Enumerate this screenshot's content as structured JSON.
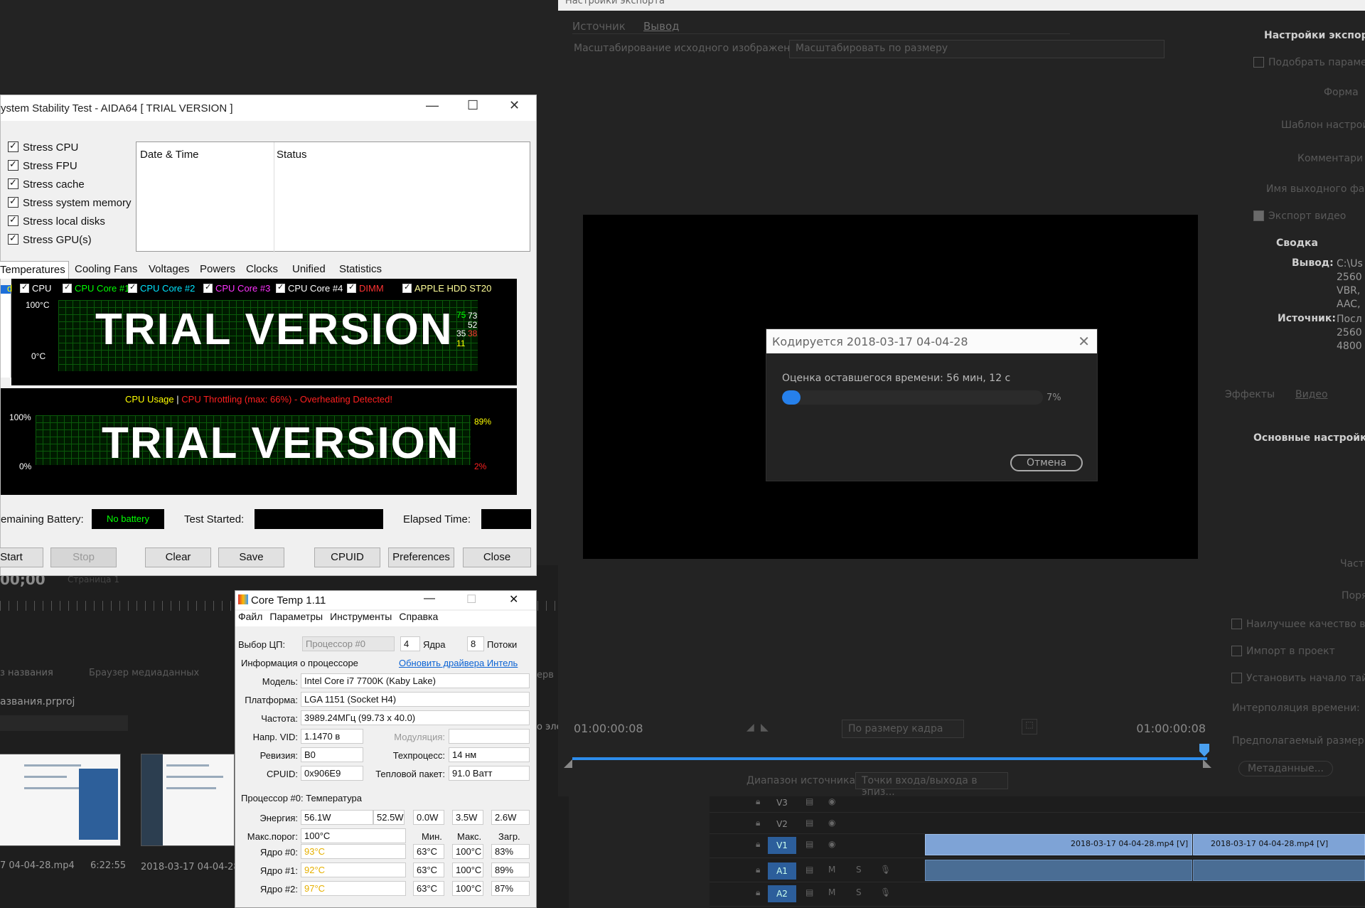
{
  "premiere_export": {
    "title": "Настройки экспорта",
    "tabs": [
      "Источник",
      "Вывод"
    ],
    "scale_label": "Масштабирование исходного изображения:",
    "scale_value": "Масштабировать по размеру",
    "right_panel": {
      "export_settings": "Настройки экспорта",
      "match_params": "Подобрать параме",
      "format": "Форма",
      "preset": "Шаблон настрой",
      "comment": "Комментари",
      "output_name": "Имя выходного фай",
      "export_video": "Экспорт видео",
      "summary": "Сводка",
      "output_label": "Вывод:",
      "output_lines": [
        "C:\\Us",
        "2560",
        "VBR,",
        "AAC,"
      ],
      "source_label": "Источник:",
      "source_lines": [
        "Посл",
        "2560",
        "4800"
      ],
      "effects_tab": "Эффекты",
      "video_tab": "Видео",
      "basic_settings": "Основные настройки",
      "freq": "Часто",
      "order": "Поря",
      "best_quality": "Наилучшее качество в",
      "import_project": "Импорт в проект",
      "set_start": "Установить начало тай",
      "interp": "Интерполяция времени:",
      "est_size": "Предполагаемый размер",
      "metadata": "Метаданные..."
    },
    "timecode_left": "01:00:00:08",
    "timecode_right": "01:00:00:08",
    "fit_select": "По размеру кадра",
    "source_range_label": "Диапазон источника:",
    "source_range_value": "Точки входа/выхода в эпиз..."
  },
  "encode_dialog": {
    "title": "Кодируется 2018-03-17 04-04-28",
    "eta": "Оценка оставшегося времени: 56 мин, 12 с",
    "progress": 0.07,
    "percent_text": "7%",
    "cancel": "Отмена"
  },
  "premiere_back": {
    "timecode": "00;00",
    "page": "Страница 1",
    "project_tab": "з названия",
    "media_tab": "Браузер медиаданных",
    "project_file": "азвания.prproj",
    "clip1_name": "7 04-04-28.mp4",
    "clip1_dur": "6:22:55",
    "clip2_name": "2018-03-17 04-04-28",
    "side_text1": "ерв",
    "side_text2": "о эле"
  },
  "timeline": {
    "tracks": [
      "V3",
      "V2",
      "V1",
      "A1",
      "A2"
    ],
    "clip_a": "2018-03-17 04-04-28.mp4 [V]",
    "clip_b": "2018-03-17 04-04-28.mp4 [V]",
    "mute": "M",
    "solo": "S"
  },
  "aida": {
    "title": "ystem Stability Test - AIDA64  [ TRIAL VERSION ]",
    "stress": [
      "Stress CPU",
      "Stress FPU",
      "Stress cache",
      "Stress system memory",
      "Stress local disks",
      "Stress GPU(s)"
    ],
    "log_headers": [
      "Date & Time",
      "Status"
    ],
    "tabs": [
      "Temperatures",
      "Cooling Fans",
      "Voltages",
      "Powers",
      "Clocks",
      "Unified",
      "Statistics"
    ],
    "legend": [
      {
        "label": "d",
        "color": "#ffff00"
      },
      {
        "label": "CPU",
        "color": "#ffffff"
      },
      {
        "label": "CPU Core #1",
        "color": "#00ff00"
      },
      {
        "label": "CPU Core #2",
        "color": "#00e5ff"
      },
      {
        "label": "CPU Core #3",
        "color": "#ff33ff"
      },
      {
        "label": "CPU Core #4",
        "color": "#ffffff"
      },
      {
        "label": "DIMM",
        "color": "#ff3333"
      },
      {
        "label": "APPLE HDD ST20",
        "color": "#ffff99"
      }
    ],
    "temp_top": "100°C",
    "temp_bottom": "0°C",
    "temp_readings": [
      {
        "v": "75",
        "c": "#00ff00"
      },
      {
        "v": "73",
        "c": "#ffffff"
      },
      {
        "v": "52",
        "c": "#ffffff"
      },
      {
        "v": "35",
        "c": "#ffffff"
      },
      {
        "v": "38",
        "c": "#ff3333"
      },
      {
        "v": "11",
        "c": "#ffff00"
      }
    ],
    "trial_text": "TRIAL VERSION",
    "usage_title": "CPU Usage",
    "usage_sep": "|",
    "throttle_text": "CPU Throttling (max: 66%) - Overheating Detected!",
    "usage_top": "100%",
    "usage_bottom": "0%",
    "usage_val": "89%",
    "throttle_val": "2%",
    "battery_label": "emaining Battery:",
    "battery_value": "No battery",
    "started_label": "Test Started:",
    "elapsed_label": "Elapsed Time:",
    "buttons": [
      "Start",
      "Stop",
      "Clear",
      "Save",
      "CPUID",
      "Preferences",
      "Close"
    ]
  },
  "coretemp": {
    "title": "Core Temp 1.11",
    "menu": [
      "Файл",
      "Параметры",
      "Инструменты",
      "Справка"
    ],
    "cpu_select_label": "Выбор ЦП:",
    "cpu_select": "Процессор #0",
    "cores_n": "4",
    "cores_label": "Ядра",
    "threads_n": "8",
    "threads_label": "Потоки",
    "info_label": "Информация о процессоре",
    "update_link": "Обновить драйвера Интель",
    "model_label": "Модель:",
    "model": "Intel Core i7 7700K (Kaby Lake)",
    "platform_label": "Платформа:",
    "platform": "LGA 1151 (Socket H4)",
    "freq_label": "Частота:",
    "freq": "3989.24МГц (99.73 x 40.0)",
    "vid_label": "Напр. VID:",
    "vid": "1.1470 в",
    "mod_label": "Модуляция:",
    "rev_label": "Ревизия:",
    "rev": "B0",
    "tech_label": "Техпроцесс:",
    "tech": "14 нм",
    "cpuid_label": "CPUID:",
    "cpuid": "0x906E9",
    "tdp_label": "Тепловой пакет:",
    "tdp": "91.0 Ватт",
    "temp_section": "Процессор #0: Температура",
    "power_label": "Энергия:",
    "power": [
      "56.1W",
      "52.5W",
      "0.0W",
      "3.5W",
      "2.6W"
    ],
    "tjmax_label": "Макс.порог:",
    "tjmax": "100°C",
    "col_min": "Мин.",
    "col_max": "Макс.",
    "col_load": "Загр.",
    "cores": [
      {
        "label": "Ядро #0:",
        "temp": "93°C",
        "min": "63°C",
        "max": "100°C",
        "load": "83%"
      },
      {
        "label": "Ядро #1:",
        "temp": "92°C",
        "min": "63°C",
        "max": "100°C",
        "load": "89%"
      },
      {
        "label": "Ядро #2:",
        "temp": "97°C",
        "min": "63°C",
        "max": "100°C",
        "load": "87%"
      }
    ]
  }
}
